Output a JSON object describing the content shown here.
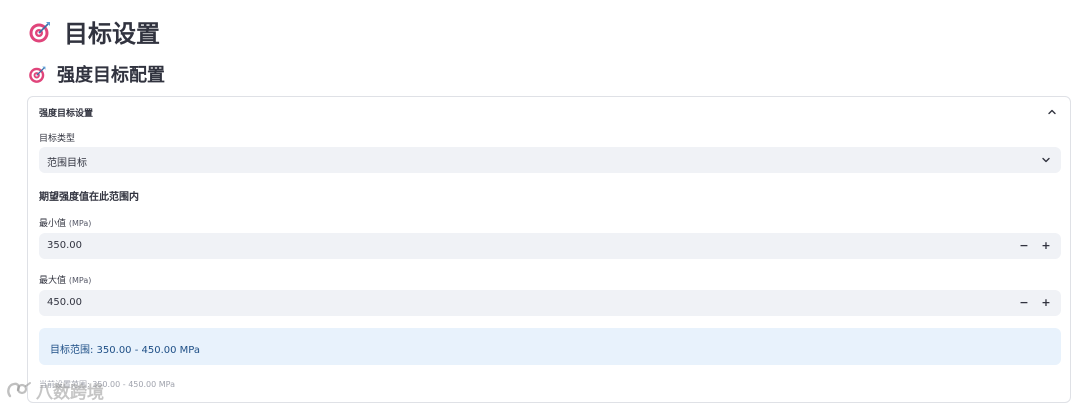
{
  "page": {
    "title": "目标设置",
    "title_icon": "target-dart-icon"
  },
  "section": {
    "title": "强度目标配置",
    "icon": "target-dart-icon"
  },
  "expander": {
    "title": "强度目标设置",
    "expanded": true,
    "target_type": {
      "label": "目标类型",
      "value": "范围目标"
    },
    "subheading": "期望强度值在此范围内",
    "min_field": {
      "label": "最小值",
      "unit": "(MPa)",
      "value": "350.00",
      "minus": "−",
      "plus": "+"
    },
    "max_field": {
      "label": "最大值",
      "unit": "(MPa)",
      "value": "450.00",
      "minus": "−",
      "plus": "+"
    },
    "info": "目标范围: 350.00 - 450.00 MPa",
    "caption": "当前设置范围: 350.00 - 450.00 MPa"
  },
  "watermark": {
    "text": "八数跨境"
  },
  "colors": {
    "text": "#31333f",
    "input_bg": "#f0f2f6",
    "info_bg": "#e8f2fc",
    "info_text": "#1e4f86",
    "border": "#dfe1e6"
  }
}
